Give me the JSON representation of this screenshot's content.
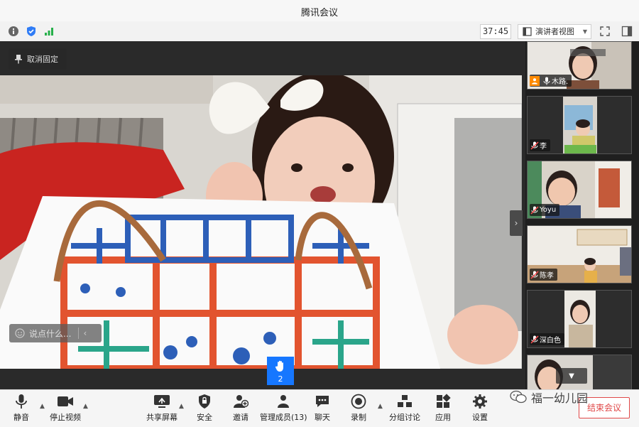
{
  "window": {
    "title": "腾讯会议"
  },
  "toolbar": {
    "icons": [
      "info-icon",
      "shield-icon",
      "signal-icon"
    ],
    "timer": "37:45",
    "view_mode": "演讲者视图",
    "fullscreen_icon": "fullscreen-icon",
    "panel_icon": "panel-toggle-icon"
  },
  "stage": {
    "unpin_label": "取消固定",
    "chat_placeholder": "说点什么...",
    "hand_raise_count": "2"
  },
  "participants": [
    {
      "name": "木路."
    },
    {
      "name": "李"
    },
    {
      "name": "Yoyu"
    },
    {
      "name": "陈孝"
    },
    {
      "name": "深白色"
    }
  ],
  "bottom_bar": {
    "mute": "静音",
    "stop_video": "停止视频",
    "share_screen": "共享屏幕",
    "security": "安全",
    "invite": "邀请",
    "manage_members": "管理成员(13)",
    "chat": "聊天",
    "record": "录制",
    "breakout": "分组讨论",
    "apps": "应用",
    "settings": "设置",
    "end_meeting": "结束会议"
  },
  "watermark": {
    "text": "福一幼儿园"
  }
}
